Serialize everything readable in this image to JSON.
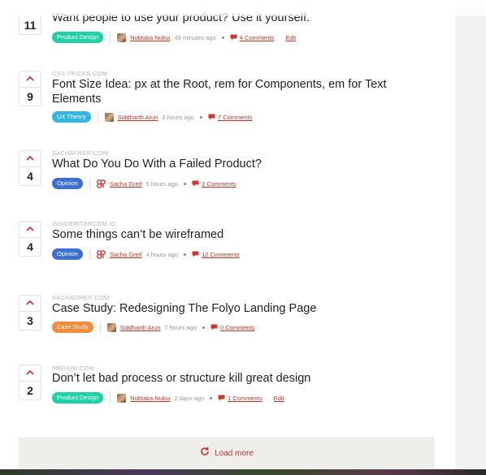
{
  "colors": {
    "accent": "#c7322b",
    "badge_product_design": "#1fd1a3",
    "badge_ux_theory": "#33b5e5",
    "badge_opinion": "#3c6fd4",
    "badge_case_study": "#f08c3a"
  },
  "posts": [
    {
      "votes": "11",
      "domain": "",
      "title": "Want people to use your product? Use it yourself.",
      "category": "Product Design",
      "category_color": "#1fd1a3",
      "author": "Nobtaka Nukui",
      "time": "43 minutes ago",
      "comments": "4 Comments",
      "edit": "Edit",
      "avatar_icon": "photo-avatar"
    },
    {
      "votes": "9",
      "domain": "CSS-TRICKS.COM",
      "title": "Font Size Idea: px at the Root, rem for Components, em for Text Elements",
      "category": "UX Theory",
      "category_color": "#33b5e5",
      "author": "Siddharth Arun",
      "time": "3 hours ago",
      "comments": "7 Comments",
      "edit": "",
      "avatar_icon": "photo-avatar"
    },
    {
      "votes": "4",
      "domain": "SACHAFREIF.COM",
      "title": "What Do You Do With a Failed Product?",
      "category": "Opinion",
      "category_color": "#3c6fd4",
      "author": "Sacha Greif",
      "time": "5 hours ago",
      "comments": "2 Comments",
      "edit": "",
      "avatar_icon": "logo-avatar"
    },
    {
      "votes": "4",
      "domain": "INSIDEINTERCOM.IO",
      "title": "Some things can’t be wireframed",
      "category": "Opinion",
      "category_color": "#3c6fd4",
      "author": "Sacha Greif",
      "time": "4 hours ago",
      "comments": "12 Comments",
      "edit": "",
      "avatar_icon": "logo-avatar"
    },
    {
      "votes": "3",
      "domain": "SACHAGREIF.COM",
      "title": "Case Study: Redesigning The Folyo Landing Page",
      "category": "Case Study",
      "category_color": "#f08c3a",
      "author": "Siddharth Arun",
      "time": "7 hours ago",
      "comments": "0 Comments",
      "edit": "",
      "avatar_icon": "photo-avatar"
    },
    {
      "votes": "2",
      "domain": "MEDIUM.COM",
      "title": "Don’t let bad process or structure kill great design",
      "category": "Product Design",
      "category_color": "#1fd1a3",
      "author": "Nobtaka Nukui",
      "time": "2 days ago",
      "comments": "1 Comments",
      "edit": "Edit",
      "avatar_icon": "photo-avatar"
    }
  ],
  "load_more": {
    "label": "Load more",
    "icon": "refresh-icon"
  }
}
